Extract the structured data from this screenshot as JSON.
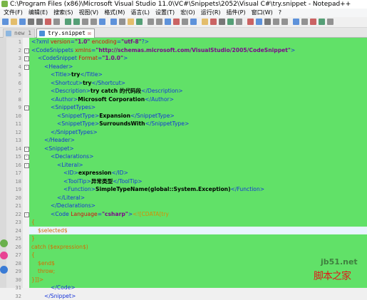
{
  "window": {
    "title": "C:\\Program Files (x86)\\Microsoft Visual Studio 11.0\\VC#\\Snippets\\2052\\Visual C#\\try.snippet - Notepad++"
  },
  "menu": [
    "文件(F)",
    "编辑(E)",
    "搜索(S)",
    "视图(V)",
    "格式(M)",
    "语言(L)",
    "设置(T)",
    "宏(O)",
    "运行(R)",
    "插件(P)",
    "窗口(W)",
    "?"
  ],
  "tabs": [
    {
      "label": "new 1",
      "active": false
    },
    {
      "label": "try.snippet",
      "active": true
    }
  ],
  "editor": {
    "current_line": 24,
    "background": "#61e168",
    "lines": [
      {
        "n": "1",
        "indent": 0,
        "fold": "",
        "segs": [
          [
            "<?xml ",
            "punct"
          ],
          [
            "version",
            "attr"
          ],
          [
            "=",
            "punct"
          ],
          [
            "\"1.0\"",
            "val"
          ],
          [
            " encoding",
            "attr"
          ],
          [
            "=",
            "punct"
          ],
          [
            "\"utf-8\"",
            "val"
          ],
          [
            "?>",
            "punct"
          ]
        ]
      },
      {
        "n": "2",
        "indent": 0,
        "fold": "-",
        "segs": [
          [
            "<CodeSnippets ",
            "tag"
          ],
          [
            "xmlns",
            "attr"
          ],
          [
            "=",
            "punct"
          ],
          [
            "\"http://schemas.microsoft.com/VisualStudio/2005/CodeSnippet\"",
            "val"
          ],
          [
            ">",
            "tag"
          ]
        ]
      },
      {
        "n": "3",
        "indent": 1,
        "fold": "-",
        "segs": [
          [
            "<CodeSnippet ",
            "tag"
          ],
          [
            "Format",
            "attr"
          ],
          [
            "=",
            "punct"
          ],
          [
            "\"1.0.0\"",
            "val"
          ],
          [
            ">",
            "tag"
          ]
        ]
      },
      {
        "n": "4",
        "indent": 2,
        "fold": "-",
        "segs": [
          [
            "<Header>",
            "tag"
          ]
        ]
      },
      {
        "n": "5",
        "indent": 3,
        "fold": "",
        "segs": [
          [
            "<Title>",
            "tag"
          ],
          [
            "try",
            "text"
          ],
          [
            "</Title>",
            "tag"
          ]
        ]
      },
      {
        "n": "6",
        "indent": 3,
        "fold": "",
        "segs": [
          [
            "<Shortcut>",
            "tag"
          ],
          [
            "try",
            "text"
          ],
          [
            "</Shortcut>",
            "tag"
          ]
        ]
      },
      {
        "n": "7",
        "indent": 3,
        "fold": "",
        "segs": [
          [
            "<Description>",
            "tag"
          ],
          [
            "try catch 的代码段",
            "text"
          ],
          [
            "</Description>",
            "tag"
          ]
        ]
      },
      {
        "n": "8",
        "indent": 3,
        "fold": "",
        "segs": [
          [
            "<Author>",
            "tag"
          ],
          [
            "Microsoft Corporation",
            "text"
          ],
          [
            "</Author>",
            "tag"
          ]
        ]
      },
      {
        "n": "9",
        "indent": 3,
        "fold": "-",
        "segs": [
          [
            "<SnippetTypes>",
            "tag"
          ]
        ]
      },
      {
        "n": "10",
        "indent": 4,
        "fold": "",
        "segs": [
          [
            "<SnippetType>",
            "tag"
          ],
          [
            "Expansion",
            "text"
          ],
          [
            "</SnippetType>",
            "tag"
          ]
        ]
      },
      {
        "n": "11",
        "indent": 4,
        "fold": "",
        "segs": [
          [
            "<SnippetType>",
            "tag"
          ],
          [
            "SurroundsWith",
            "text"
          ],
          [
            "</SnippetType>",
            "tag"
          ]
        ]
      },
      {
        "n": "12",
        "indent": 3,
        "fold": "",
        "segs": [
          [
            "</SnippetTypes>",
            "tag"
          ]
        ]
      },
      {
        "n": "13",
        "indent": 2,
        "fold": "",
        "segs": [
          [
            "</Header>",
            "tag"
          ]
        ]
      },
      {
        "n": "14",
        "indent": 2,
        "fold": "-",
        "segs": [
          [
            "<Snippet>",
            "tag"
          ]
        ]
      },
      {
        "n": "15",
        "indent": 3,
        "fold": "-",
        "segs": [
          [
            "<Declarations>",
            "tag"
          ]
        ]
      },
      {
        "n": "16",
        "indent": 4,
        "fold": "-",
        "segs": [
          [
            "<Literal>",
            "tag"
          ]
        ]
      },
      {
        "n": "17",
        "indent": 5,
        "fold": "",
        "segs": [
          [
            "<ID>",
            "tag"
          ],
          [
            "expression",
            "text"
          ],
          [
            "</ID>",
            "tag"
          ]
        ]
      },
      {
        "n": "18",
        "indent": 5,
        "fold": "",
        "segs": [
          [
            "<ToolTip>",
            "tag"
          ],
          [
            "异常类型",
            "text"
          ],
          [
            "</ToolTip>",
            "tag"
          ]
        ]
      },
      {
        "n": "19",
        "indent": 5,
        "fold": "",
        "segs": [
          [
            "<Function>",
            "tag"
          ],
          [
            "SimpleTypeName(global::System.Exception)",
            "text"
          ],
          [
            "</Function>",
            "tag"
          ]
        ]
      },
      {
        "n": "20",
        "indent": 4,
        "fold": "",
        "segs": [
          [
            "</Literal>",
            "tag"
          ]
        ]
      },
      {
        "n": "21",
        "indent": 3,
        "fold": "",
        "segs": [
          [
            "</Declarations>",
            "tag"
          ]
        ]
      },
      {
        "n": "22",
        "indent": 3,
        "fold": "-",
        "segs": [
          [
            "<Code ",
            "tag"
          ],
          [
            "Language",
            "attr"
          ],
          [
            "=",
            "punct"
          ],
          [
            "\"csharp\"",
            "val"
          ],
          [
            ">",
            "tag"
          ],
          [
            "<![CDATA[try",
            "cdata"
          ]
        ]
      },
      {
        "n": "23",
        "indent": 0,
        "fold": "",
        "segs": [
          [
            "{",
            "code"
          ]
        ]
      },
      {
        "n": "24",
        "indent": 1,
        "fold": "",
        "segs": [
          [
            "$selected$",
            "code"
          ]
        ]
      },
      {
        "n": "25",
        "indent": 0,
        "fold": "",
        "segs": [
          [
            "}",
            "code"
          ]
        ]
      },
      {
        "n": "26",
        "indent": 0,
        "fold": "",
        "segs": [
          [
            "catch ($expression$)",
            "code"
          ]
        ]
      },
      {
        "n": "27",
        "indent": 0,
        "fold": "",
        "segs": [
          [
            "{",
            "code"
          ]
        ]
      },
      {
        "n": "28",
        "indent": 1,
        "fold": "",
        "segs": [
          [
            "$end$",
            "code"
          ]
        ]
      },
      {
        "n": "29",
        "indent": 1,
        "fold": "",
        "segs": [
          [
            "throw;",
            "code"
          ]
        ]
      },
      {
        "n": "30",
        "indent": 0,
        "fold": "",
        "segs": [
          [
            "}]]>",
            "code"
          ]
        ]
      },
      {
        "n": "31",
        "indent": 3,
        "fold": "",
        "segs": [
          [
            "</Code>",
            "tag"
          ]
        ]
      },
      {
        "n": "32",
        "indent": 2,
        "fold": "",
        "segs": [
          [
            "</Snippet>",
            "tag"
          ]
        ]
      }
    ]
  },
  "watermark": {
    "line1": "jb51.net",
    "line2": "脚本之家"
  }
}
